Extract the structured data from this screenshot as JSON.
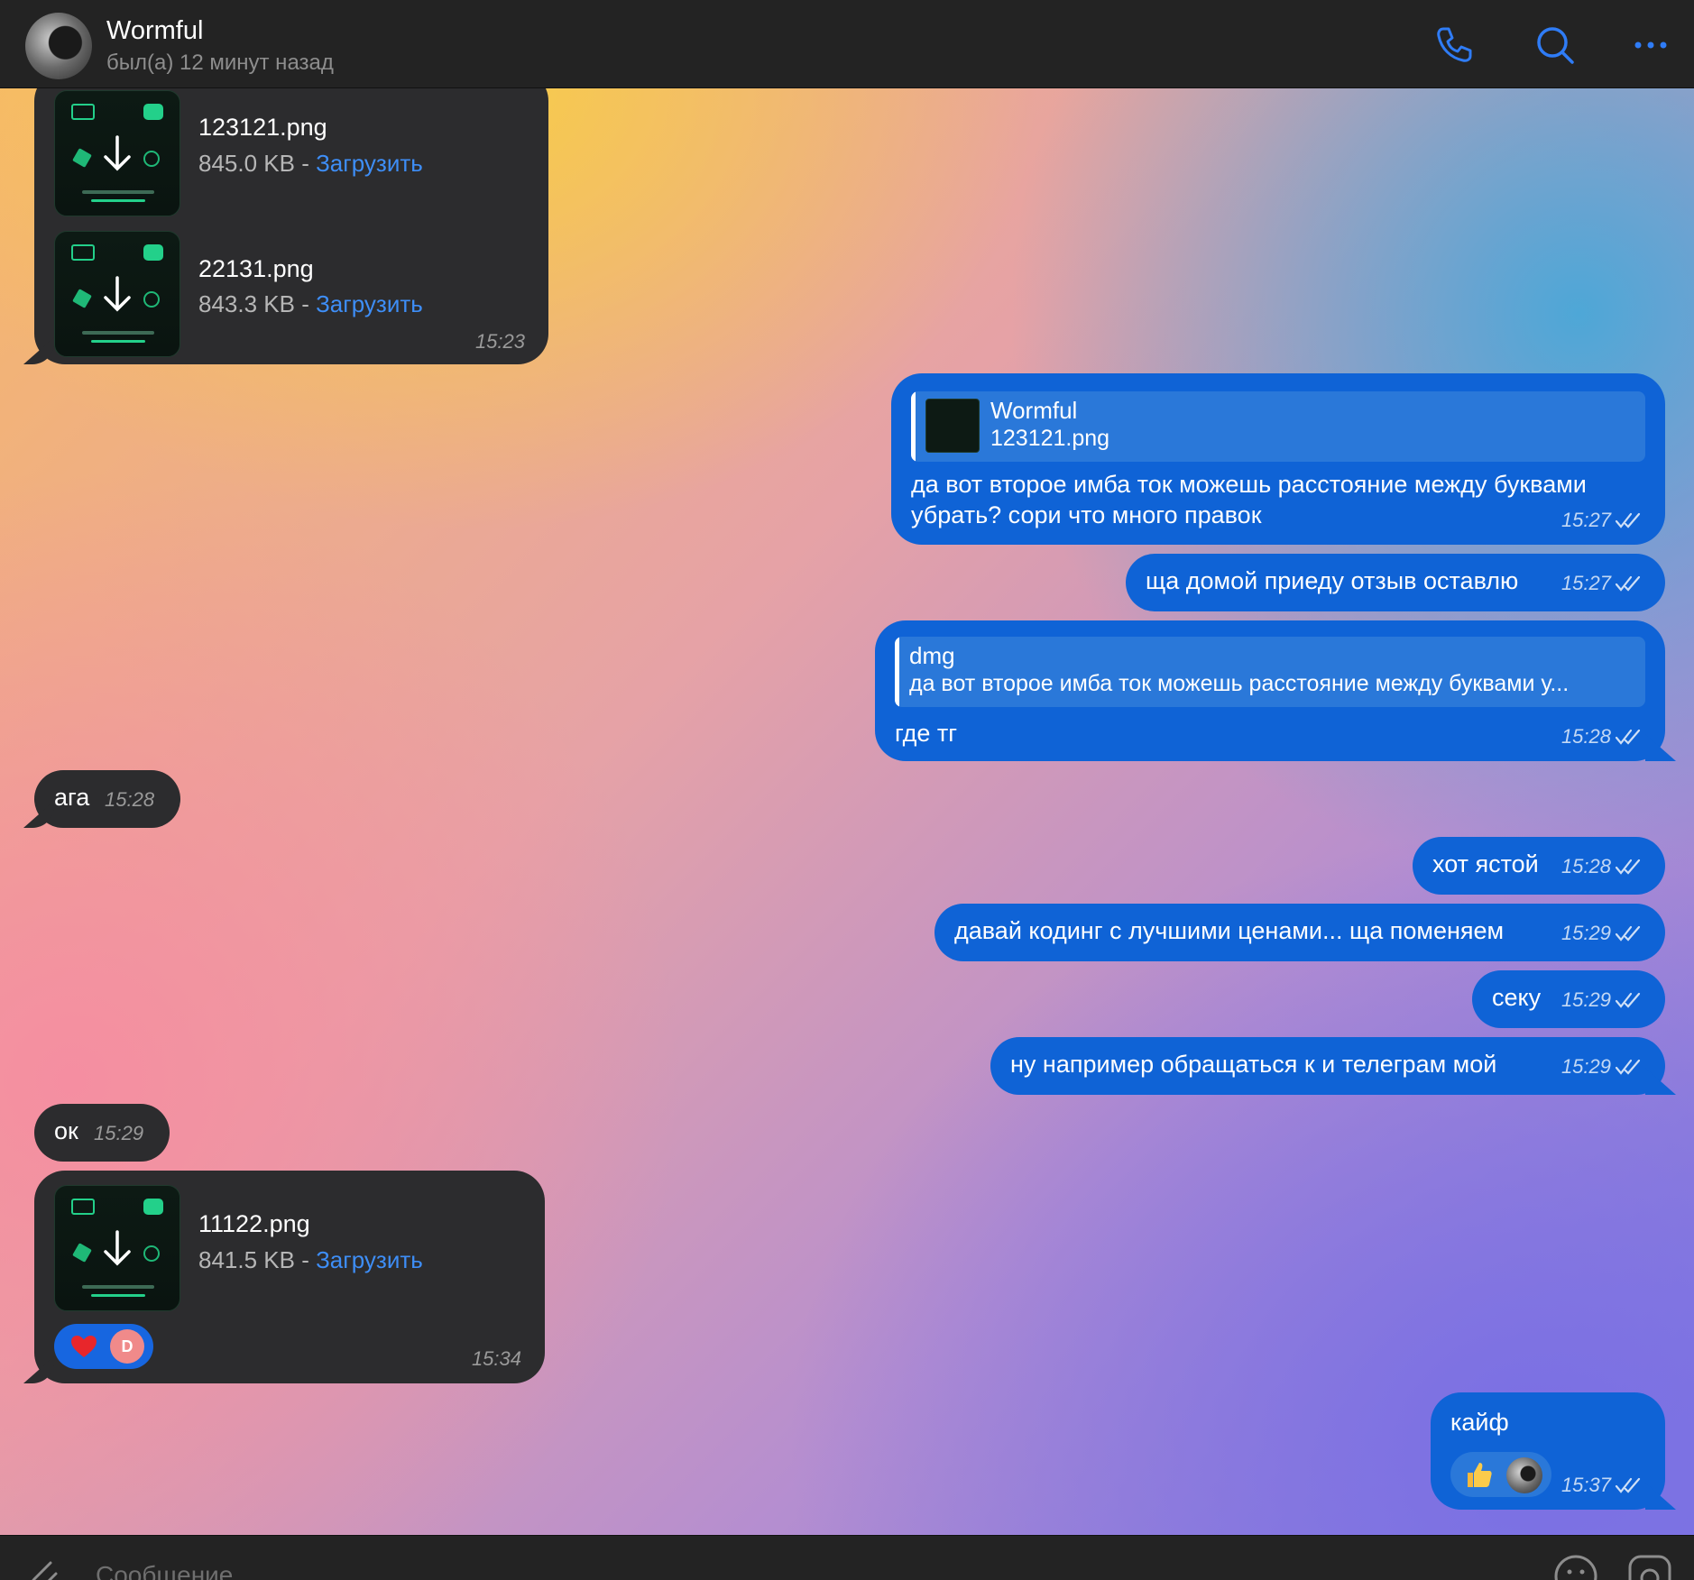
{
  "header": {
    "contact_name": "Wormful",
    "status": "был(а) 12 минут назад",
    "icons": [
      "phone-icon",
      "search-icon",
      "more-icon"
    ],
    "accent_color": "#2f7cf6"
  },
  "messages": {
    "m1": {
      "files": [
        {
          "name": "123121.png",
          "size": "845.0 KB - ",
          "action": "Загрузить"
        },
        {
          "name": "22131.png",
          "size": "843.3 KB - ",
          "action": "Загрузить"
        }
      ],
      "time": "15:23"
    },
    "m2": {
      "reply_name": "Wormful",
      "reply_text": "123121.png",
      "line1": "да вот второе имба ток можешь расстояние между буквами",
      "line2": "убрать? сори что много правок",
      "time": "15:27"
    },
    "m3": {
      "text": "ща домой приеду отзыв оставлю",
      "time": "15:27"
    },
    "m4": {
      "reply_name": "dmg",
      "reply_text": "да вот второе имба ток можешь расстояние между буквами у...",
      "text": "где тг",
      "time": "15:28"
    },
    "m5": {
      "text": "ага",
      "time": "15:28"
    },
    "m6": {
      "text": "хот ястой",
      "time": "15:28"
    },
    "m7": {
      "text": "давай кодинг с лучшими ценами... ща поменяем",
      "time": "15:29"
    },
    "m8": {
      "text": "секу",
      "time": "15:29"
    },
    "m9": {
      "text": "ну например обращаться к  и телеграм мой",
      "time": "15:29"
    },
    "m10": {
      "text": "ок",
      "time": "15:29"
    },
    "m11": {
      "file": {
        "name": "11122.png",
        "size": "841.5 KB - ",
        "action": "Загрузить"
      },
      "reaction_emoji": "heart",
      "reaction_user_initial": "D",
      "time": "15:34"
    },
    "m12": {
      "text": "кайф",
      "reaction_emoji": "thumbs-up",
      "time": "15:37"
    }
  },
  "composer": {
    "placeholder": "Сообщение"
  },
  "colors": {
    "incoming_bubble": "#2c2c2e",
    "outgoing_bubble": "#0f63d6",
    "link": "#3e8ef7"
  }
}
